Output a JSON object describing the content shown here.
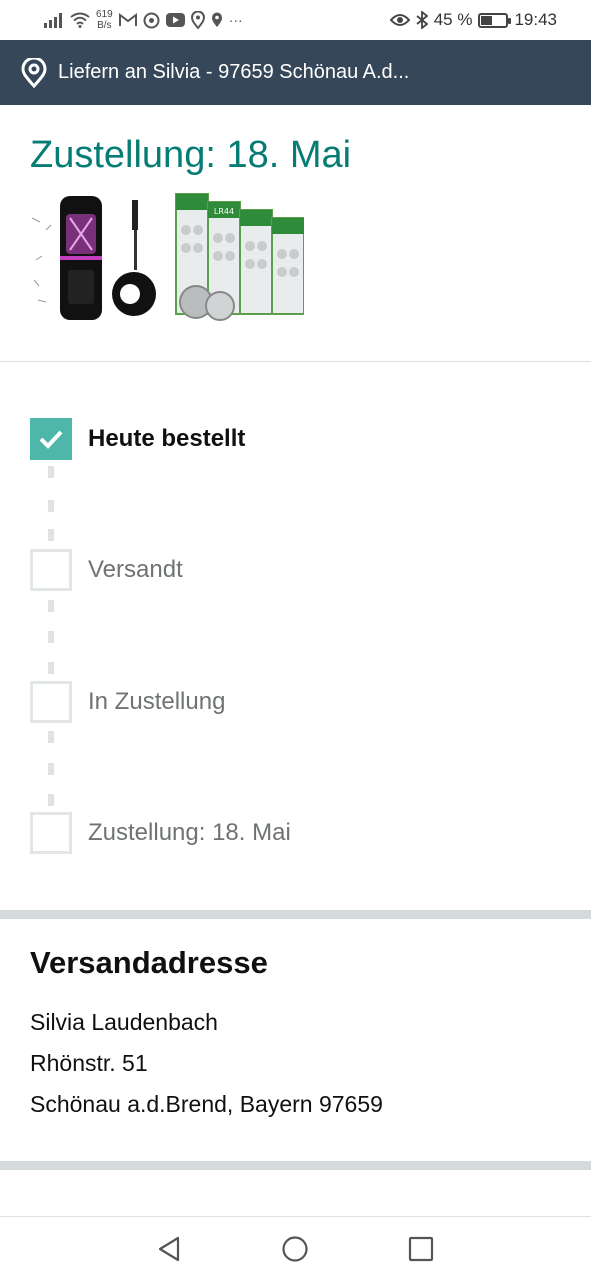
{
  "status_bar": {
    "net_speed_value": "619",
    "net_speed_unit": "B/s",
    "battery_percent": "45 %",
    "battery_level": 0.45,
    "time": "19:43",
    "more_label": "···"
  },
  "delivery_bar": {
    "text": "Liefern an Silvia - 97659 Schönau A.d..."
  },
  "order": {
    "title": "Zustellung: 18. Mai",
    "products": [
      {
        "name": "mosquito-lamp-image"
      },
      {
        "name": "lr44-batteries-image",
        "label": "LR44"
      }
    ]
  },
  "tracker": {
    "steps": [
      {
        "label": "Heute bestellt",
        "done": true
      },
      {
        "label": "Versandt",
        "done": false
      },
      {
        "label": "In Zustellung",
        "done": false
      },
      {
        "label": "Zustellung: 18. Mai",
        "done": false
      }
    ]
  },
  "address": {
    "heading": "Versandadresse",
    "lines": [
      "Silvia Laudenbach",
      "Rhönstr. 51",
      "Schönau a.d.Brend, Bayern 97659"
    ]
  },
  "colors": {
    "accent": "#067d74",
    "check": "#4fb7a9",
    "header": "#37475a"
  }
}
